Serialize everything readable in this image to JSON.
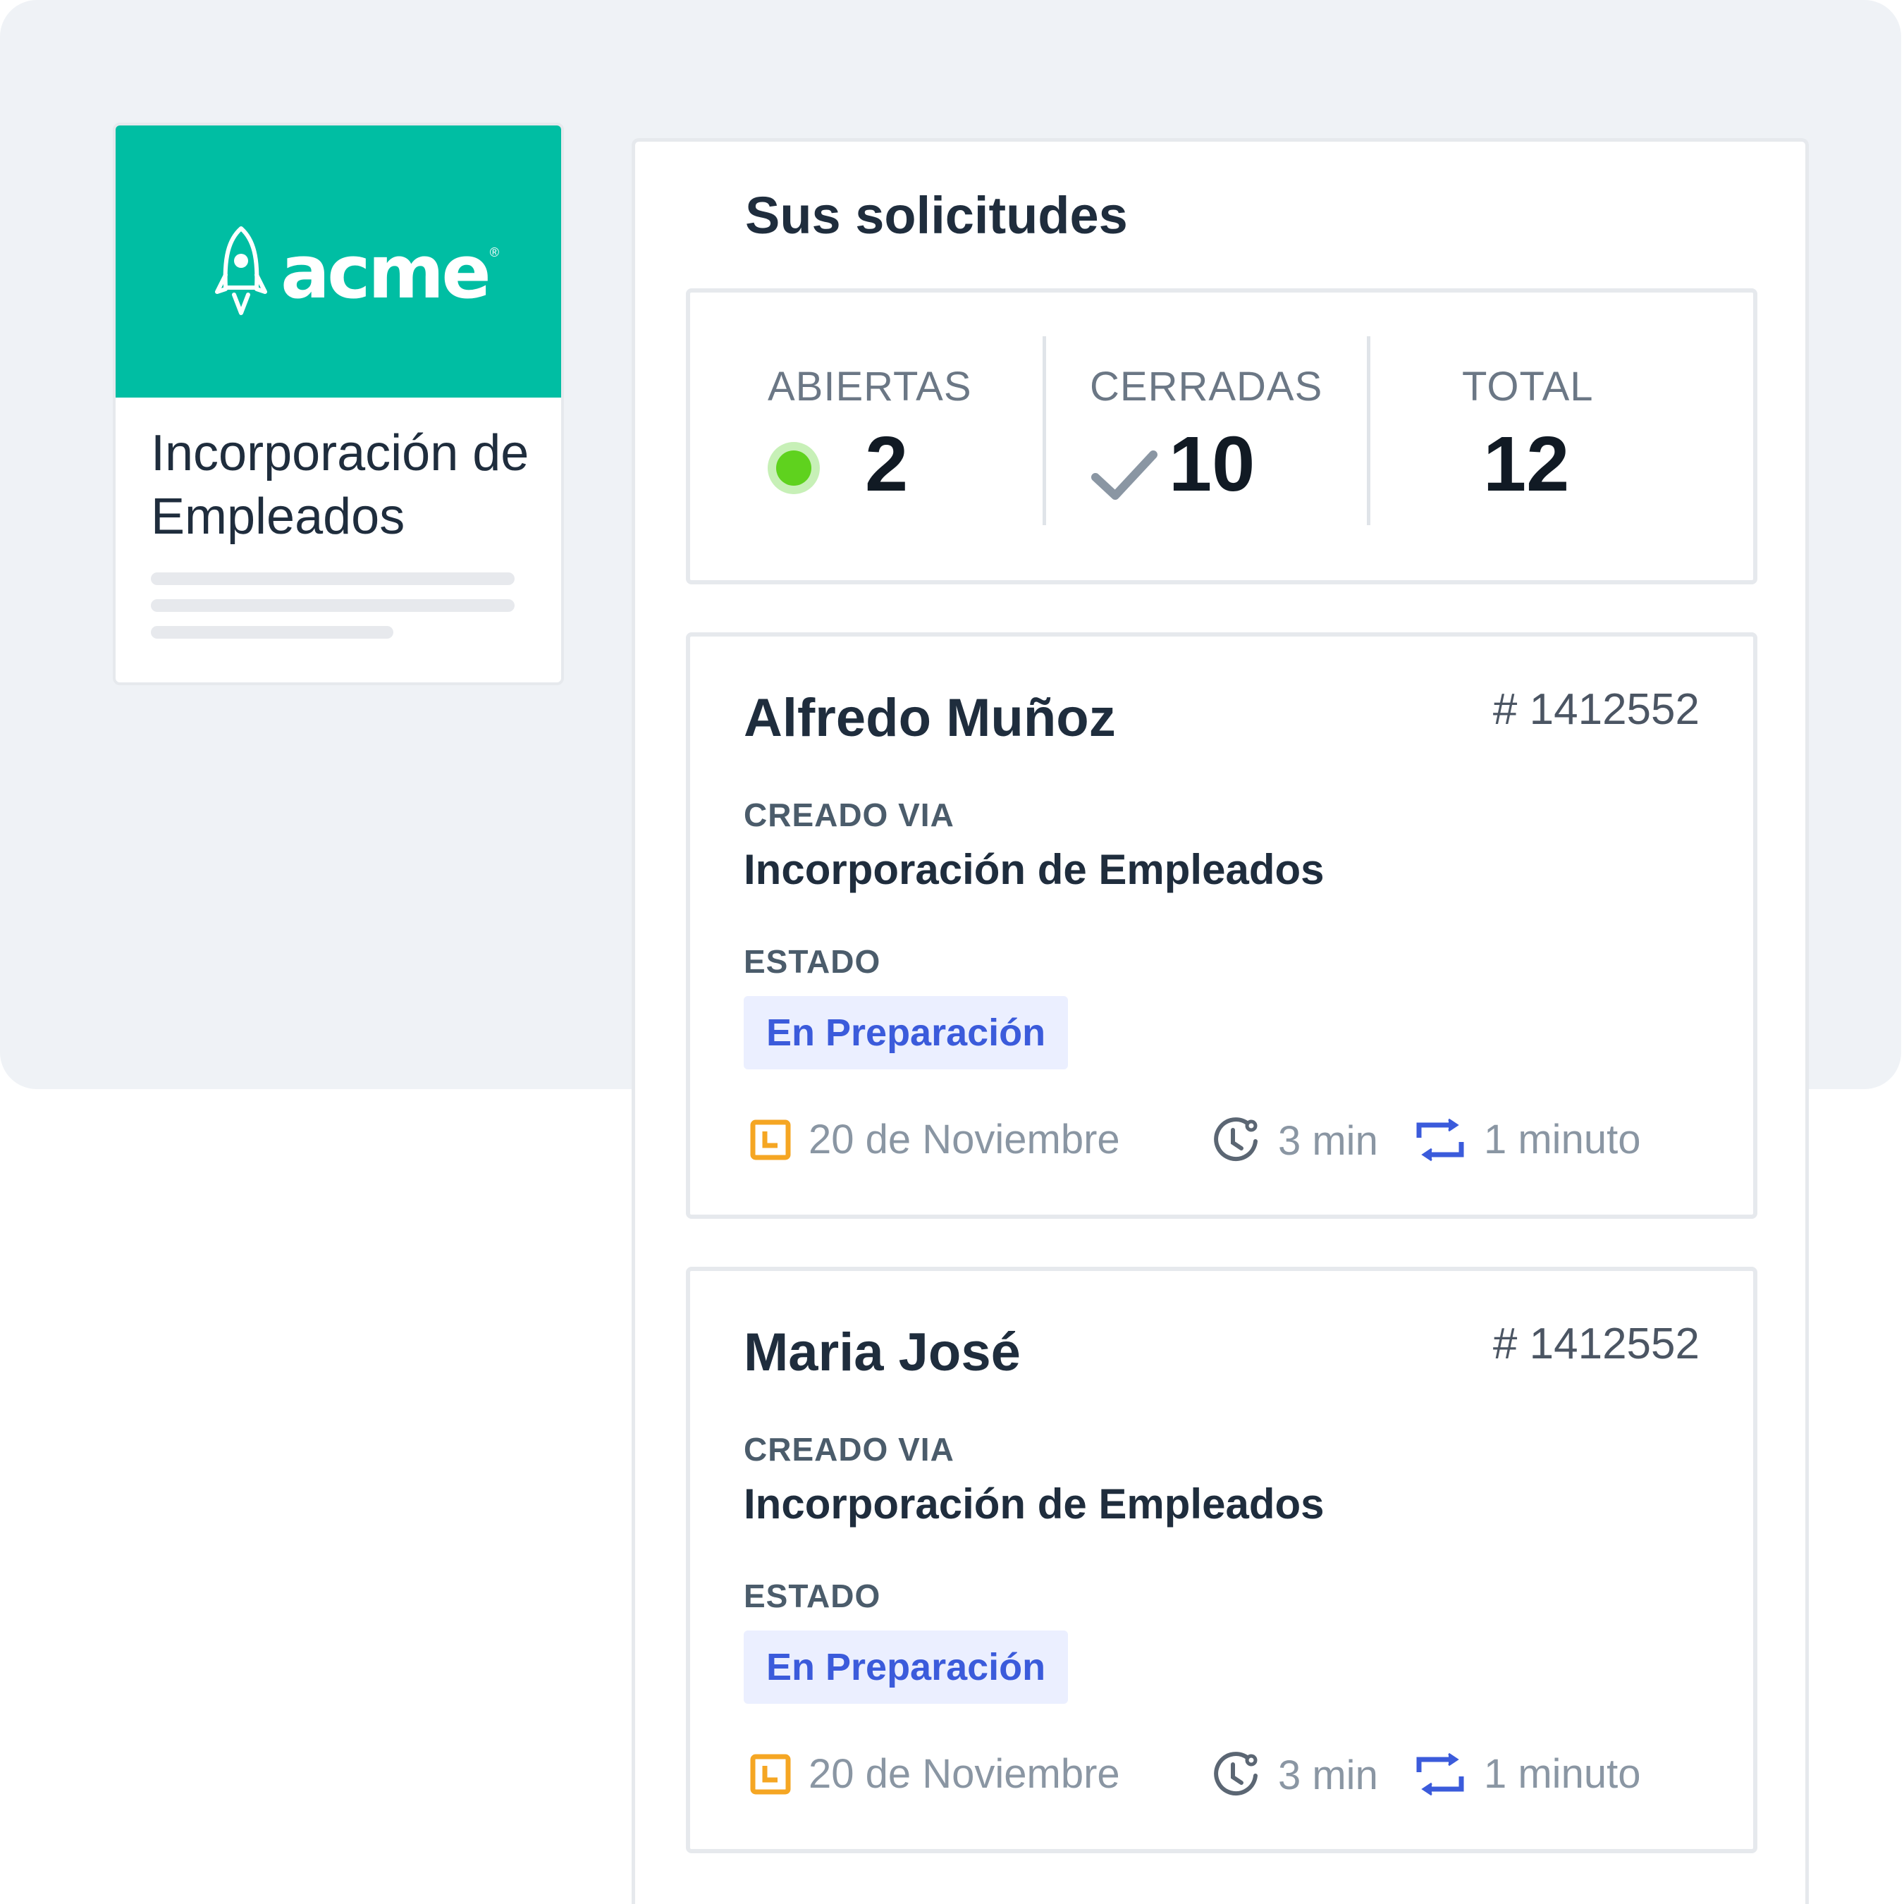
{
  "service": {
    "brand": "acme",
    "title": "Incorporación de Empleados"
  },
  "main": {
    "title": "Sus solicitudes",
    "stats": {
      "open_label": "ABIERTAS",
      "open_value": "2",
      "closed_label": "CERRADAS",
      "closed_value": "10",
      "total_label": "TOTAL",
      "total_value": "12"
    },
    "requests": [
      {
        "name": "Alfredo Muñoz",
        "id": "# 1412552",
        "created_label": "CREADO VIA",
        "created_value": "Incorporación de Empleados",
        "status_label": "ESTADO",
        "status": "En Preparación",
        "date": "20 de Noviembre",
        "duration": "3 min",
        "updated": "1 minuto"
      },
      {
        "name": "Maria José",
        "id": "# 1412552",
        "created_label": "CREADO VIA",
        "created_value": "Incorporación de Empleados",
        "status_label": "ESTADO",
        "status": "En Preparación",
        "date": "20 de Noviembre",
        "duration": "3 min",
        "updated": "1 minuto"
      }
    ]
  },
  "colors": {
    "brand": "#00bea3",
    "open_dot": "#5fd21e",
    "badge_text": "#3b5bdb",
    "badge_bg": "#ebefff",
    "calendar_icon": "#f5a623",
    "refresh_icon": "#3b5bdb"
  },
  "icons": [
    "rocket-icon",
    "status-dot-icon",
    "check-icon",
    "calendar-icon",
    "clock-icon",
    "refresh-icon"
  ]
}
